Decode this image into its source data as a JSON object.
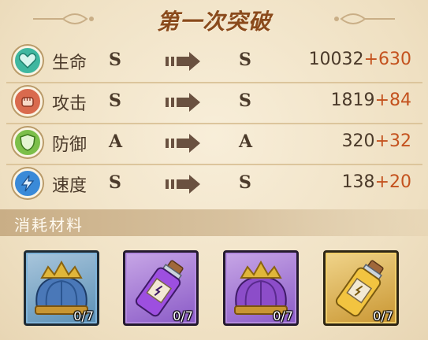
{
  "title": "第一次突破",
  "stats": [
    {
      "name": "生命",
      "from": "S",
      "to": "S",
      "base": "10032",
      "bonus": "+630",
      "icon": "heart-icon",
      "color": "#3fb7a0"
    },
    {
      "name": "攻击",
      "from": "S",
      "to": "S",
      "base": "1819",
      "bonus": "+84",
      "icon": "fist-icon",
      "color": "#d96a4e"
    },
    {
      "name": "防御",
      "from": "A",
      "to": "A",
      "base": "320",
      "bonus": "+32",
      "icon": "shield-icon",
      "color": "#7cbf4a"
    },
    {
      "name": "速度",
      "from": "S",
      "to": "S",
      "base": "138",
      "bonus": "+20",
      "icon": "lightning-icon",
      "color": "#3a8ad8"
    }
  ],
  "materials": {
    "header": "消耗材料",
    "items": [
      {
        "count": "0/7",
        "icon": "crown-icon",
        "rarity_color": "#5a8fb5"
      },
      {
        "count": "0/7",
        "icon": "potion-icon",
        "rarity_color": "#8a5ac7"
      },
      {
        "count": "0/7",
        "icon": "crown-icon",
        "rarity_color": "#8a5ac7"
      },
      {
        "count": "0/7",
        "icon": "potion-icon",
        "rarity_color": "#d4a83a"
      }
    ]
  }
}
